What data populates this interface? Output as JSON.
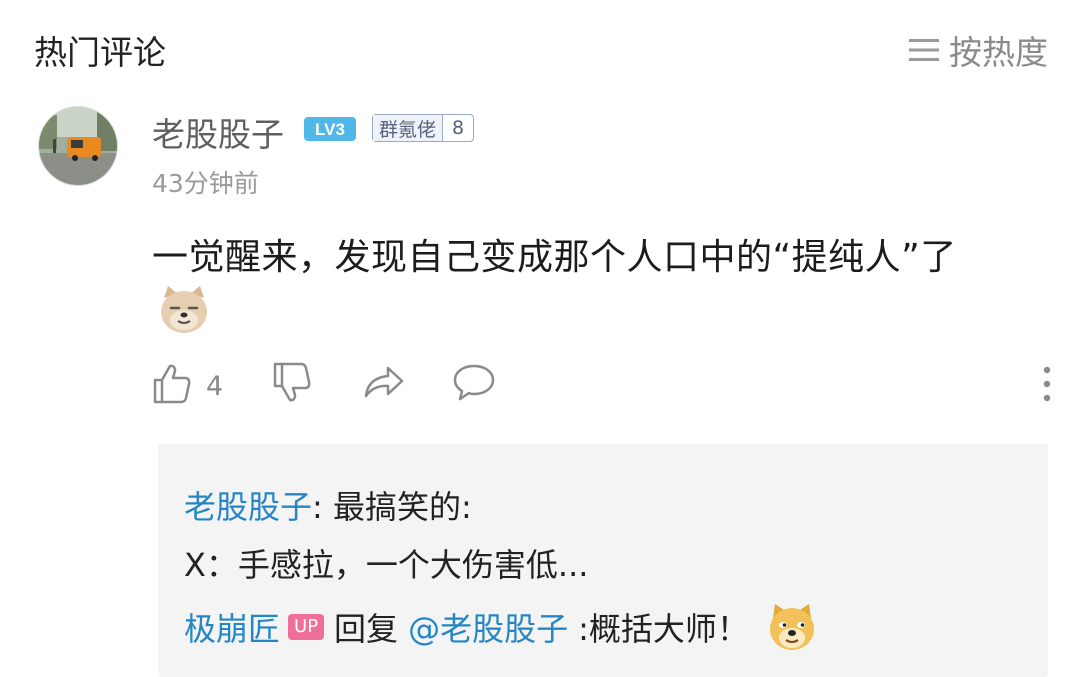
{
  "header": {
    "section_title": "热门评论",
    "sort_label": "按热度"
  },
  "comment": {
    "username": "老股股子",
    "level_badge": "LV3",
    "fan_badge": {
      "name": "群氪佬",
      "level": "8"
    },
    "timestamp": "43分钟前",
    "text": "一觉醒来，发现自己变成那个人口中的“提纯人”了",
    "likes_count": "4"
  },
  "replies": {
    "line1": {
      "user": "老股股子",
      "text": ": 最搞笑的:"
    },
    "line2": {
      "text": "X：手感拉，一个大伤害低..."
    },
    "line3": {
      "user": "极崩匠",
      "up_tag": "UP",
      "reply_word": "回复",
      "mention": "@老股股子",
      "text": ":概括大师！"
    }
  },
  "colors": {
    "link_blue": "#2486c4",
    "level_badge": "#4fb8e8",
    "up_tag": "#f06f98",
    "reply_bg": "#f4f4f4"
  }
}
